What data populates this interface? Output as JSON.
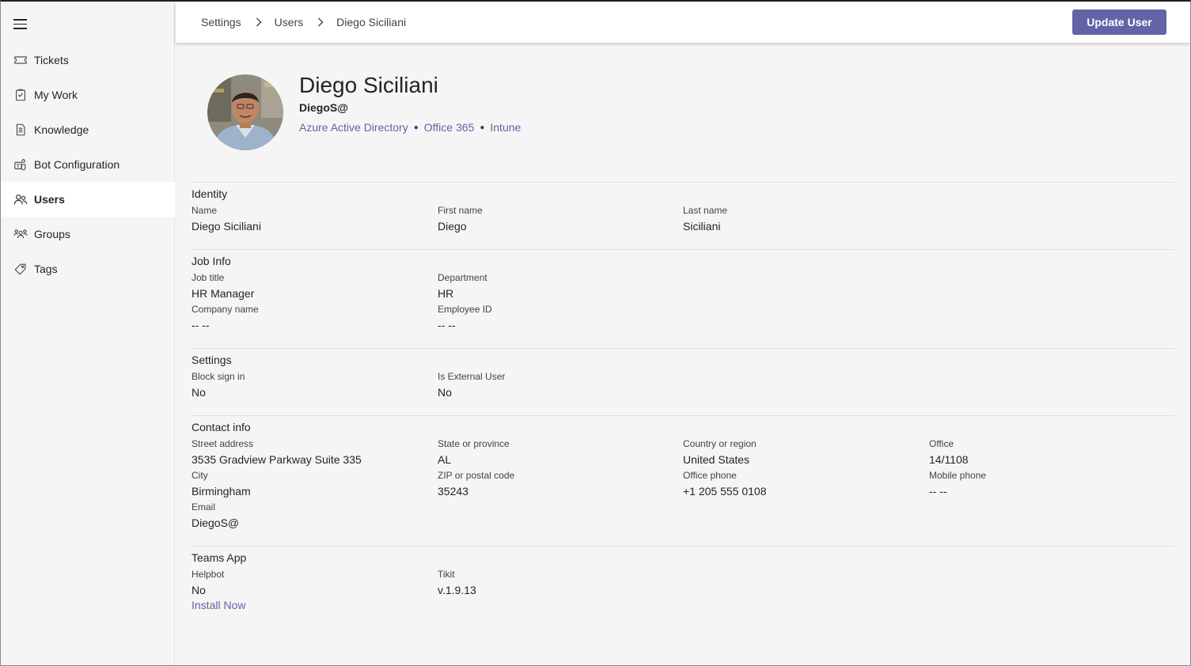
{
  "sidebar": {
    "items": [
      {
        "label": "Tickets",
        "icon": "ticket-icon"
      },
      {
        "label": "My Work",
        "icon": "clipboard-icon"
      },
      {
        "label": "Knowledge",
        "icon": "document-icon"
      },
      {
        "label": "Bot Configuration",
        "icon": "bot-icon"
      },
      {
        "label": "Users",
        "icon": "users-icon",
        "active": true
      },
      {
        "label": "Groups",
        "icon": "groups-icon"
      },
      {
        "label": "Tags",
        "icon": "tag-icon"
      }
    ]
  },
  "header": {
    "breadcrumb": [
      "Settings",
      "Users",
      "Diego Siciliani"
    ],
    "update_label": "Update User"
  },
  "profile": {
    "name": "Diego Siciliani",
    "upn": "DiegoS@",
    "sources": [
      "Azure Active Directory",
      "Office 365",
      "Intune"
    ]
  },
  "identity": {
    "title": "Identity",
    "name_label": "Name",
    "name_value": "Diego Siciliani",
    "first_label": "First name",
    "first_value": "Diego",
    "last_label": "Last name",
    "last_value": "Siciliani"
  },
  "job": {
    "title": "Job Info",
    "job_title_label": "Job title",
    "job_title_value": "HR Manager",
    "department_label": "Department",
    "department_value": "HR",
    "company_label": "Company name",
    "company_value": "-- --",
    "employee_label": "Employee ID",
    "employee_value": "-- --"
  },
  "settings": {
    "title": "Settings",
    "block_label": "Block sign in",
    "block_value": "No",
    "external_label": "Is External User",
    "external_value": "No"
  },
  "contact": {
    "title": "Contact info",
    "street_label": "Street address",
    "street_value": "3535 Gradview Parkway Suite 335",
    "state_label": "State or province",
    "state_value": "AL",
    "country_label": "Country or region",
    "country_value": "United States",
    "office_label": "Office",
    "office_value": "14/1108",
    "city_label": "City",
    "city_value": "Birmingham",
    "zip_label": "ZIP or postal code",
    "zip_value": "35243",
    "office_phone_label": "Office phone",
    "office_phone_value": "+1 205 555 0108",
    "mobile_label": "Mobile phone",
    "mobile_value": "-- --",
    "email_label": "Email",
    "email_value": "DiegoS@"
  },
  "teams": {
    "title": "Teams App",
    "helpbot_label": "Helpbot",
    "helpbot_value": "No",
    "tikit_label": "Tikit",
    "tikit_value": "v.1.9.13",
    "install_label": "Install Now"
  },
  "colors": {
    "accent": "#6264a7",
    "background": "#f5f5f5",
    "active_nav": "#ffffff"
  }
}
